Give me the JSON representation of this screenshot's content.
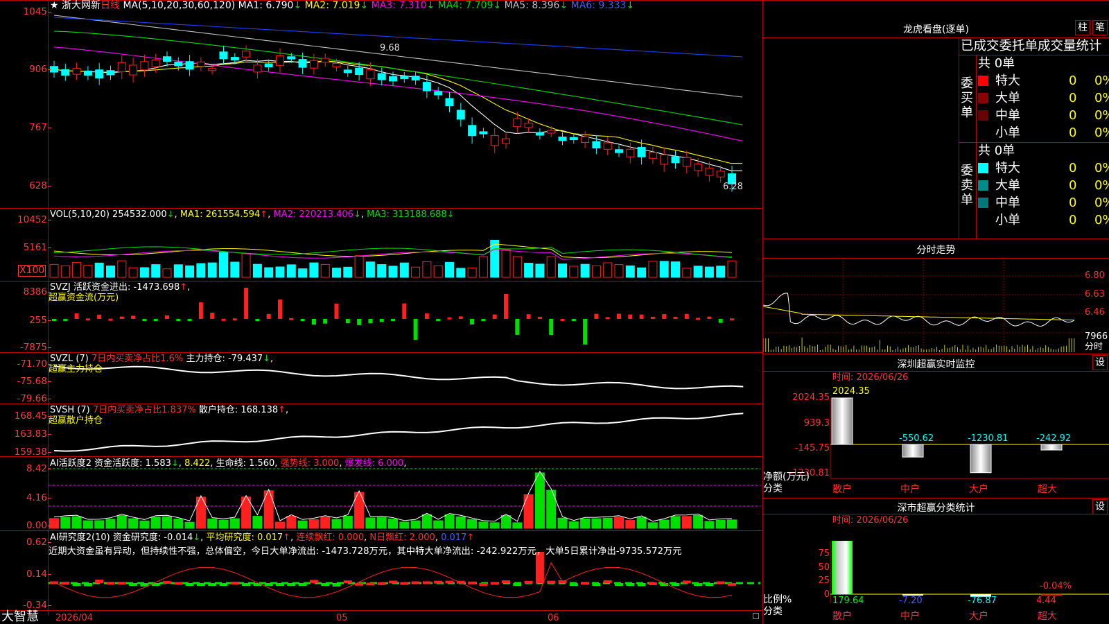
{
  "stock": {
    "star": "★",
    "name": "浙大网新",
    "period": "日线",
    "ma_title": "MA(5,10,20,30,60,120)",
    "ma1": "MA1: 6.790",
    "ma2": "MA2: 7.019",
    "ma3": "MA3: 7.310",
    "ma4": "MA4: 7.709",
    "ma5": "MA5: 8.396",
    "ma6": "MA6: 9.333",
    "arrow_down": "↓",
    "arrow_up": "↑",
    "high_mark": "9.68",
    "low_mark": "6.28",
    "axis": [
      "1045",
      "906",
      "767",
      "628"
    ]
  },
  "vol": {
    "title": "VOL(5,10,20)",
    "value": "254532.000",
    "ma1": "MA1: 261554.594",
    "ma2": "MA2: 220213.406",
    "ma3": "MA3: 313188.688",
    "axis": [
      "10452",
      "5161"
    ],
    "unit": "X100"
  },
  "svzj": {
    "title": "SVZJ",
    "text": "活跃资金进出: -1473.698",
    "sub": "超赢资金流(万元)",
    "axis": [
      "8386",
      "255",
      "-7875"
    ]
  },
  "svzl": {
    "title": "SVZL (7)",
    "pct": "7日内买卖净占比1.6%",
    "text": "主力持仓: -79.437",
    "sub": "超赢主力持仓",
    "axis": [
      "-71.70",
      "-75.68",
      "-79.66"
    ]
  },
  "svsh": {
    "title": "SVSH (7)",
    "pct": "7日内买卖净占比1.837%",
    "text": "散户持仓: 168.138",
    "sub": "超赢散户持仓",
    "axis": [
      "168.45",
      "163.83",
      "159.38"
    ]
  },
  "ai2": {
    "title": "AI活跃度2",
    "a": "资金活跃度: 1.583",
    "b": "8.422",
    "c": "生命线: 1.560",
    "d": "强势线: 3.000",
    "e": "爆发线: 6.000",
    "axis": [
      "8.42",
      "4.16",
      "0.00"
    ]
  },
  "ai_r": {
    "title": "AI研究度2(10)",
    "a": "资金研究度: -0.014",
    "b": "平均研究度: 0.017",
    "c": "连续飘红: 0.000",
    "d": "N日飘红: 2.000",
    "e": "0.017",
    "axis": [
      "0.62",
      "0.14",
      "-0.34"
    ],
    "comment": "近期大资金虽有异动，但持续性不强，总体偏空，今日大单净流出: -1473.728万元，其中特大单净流出: -242.922万元，大单5日累计净出-9735.572万元"
  },
  "footer": {
    "logo": "大智慧",
    "date1": "2026/04",
    "date2": "05",
    "date3": "06"
  },
  "longhu": {
    "title": "龙虎看盘(逐单)",
    "tab1": "柱",
    "tab2": "笔",
    "header": "已成交委托单成交量统计",
    "buy_label": [
      "委",
      "买",
      "单"
    ],
    "sell_label": [
      "委",
      "卖",
      "单"
    ],
    "count": "共 0单",
    "buy_rows": [
      {
        "name": "特大",
        "v": "0",
        "p": "0%",
        "c": "#ff0000"
      },
      {
        "name": "大单",
        "v": "0",
        "p": "0%",
        "c": "#8b0000"
      },
      {
        "name": "中单",
        "v": "0",
        "p": "0%",
        "c": "#6a0000"
      },
      {
        "name": "小单",
        "v": "0",
        "p": "0%",
        "c": ""
      }
    ],
    "sell_rows": [
      {
        "name": "特大",
        "v": "0",
        "p": "0%",
        "c": "#00ffff"
      },
      {
        "name": "大单",
        "v": "0",
        "p": "0%",
        "c": "#008b8b"
      },
      {
        "name": "中单",
        "v": "0",
        "p": "0%",
        "c": "#007878"
      },
      {
        "name": "小单",
        "v": "0",
        "p": "0%",
        "c": ""
      }
    ]
  },
  "intraday": {
    "title": "分时走势",
    "axis": [
      "6.80",
      "6.63",
      "6.46"
    ],
    "vol": "7966",
    "vol_unit": "分时"
  },
  "monitor": {
    "title": "深圳超赢实时监控",
    "set": "设",
    "time": "时间: 2026/06/26",
    "axis": [
      "2024.35",
      "939.3",
      "-145.75",
      "-1230.81"
    ],
    "unit": "净额(万元)",
    "cat_label": "分类",
    "cats": [
      "散户",
      "中户",
      "大户",
      "超大"
    ],
    "values": [
      2024.35,
      -550.62,
      -1230.81,
      -242.92
    ],
    "value_labels": [
      "2024.35",
      "-550.62",
      "-1230.81",
      "-242.92"
    ]
  },
  "classify": {
    "title": "深市超赢分类统计",
    "set": "设",
    "time": "时间: 2026/06/26",
    "axis": [
      "75",
      "50",
      "25",
      "0"
    ],
    "unit": "比例%",
    "cat_label": "分类",
    "cats": [
      "散户",
      "中户",
      "大户",
      "超大"
    ],
    "values": [
      179.64,
      -7.2,
      -76.87,
      4.44
    ],
    "value_labels": [
      "179.64",
      "-7.20",
      "-76.87",
      "4.44"
    ],
    "top_label": "-0.04%"
  }
}
